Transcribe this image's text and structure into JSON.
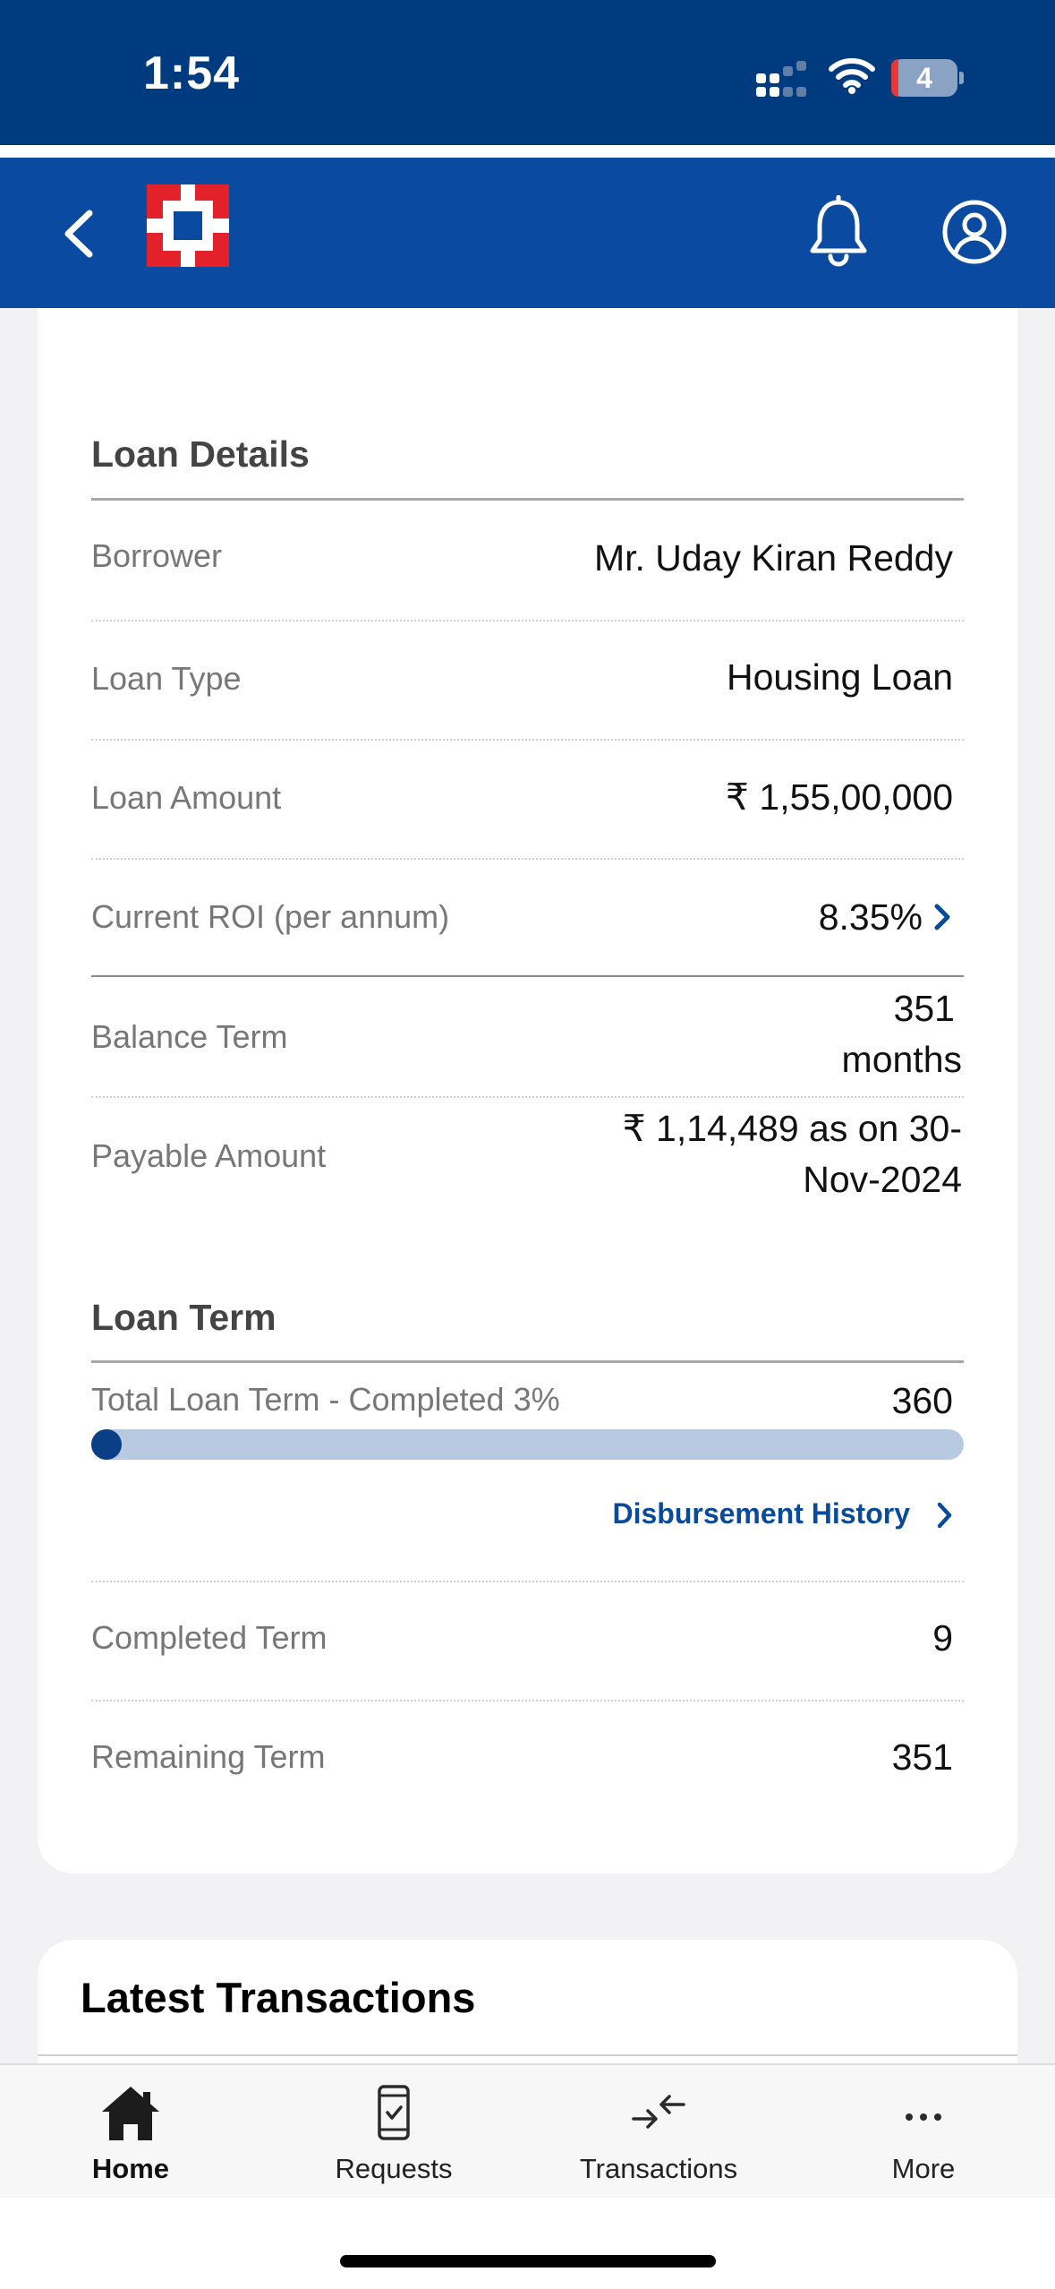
{
  "status_bar": {
    "time": "1:54",
    "battery": "4"
  },
  "colors": {
    "primary": "#0a4aa0",
    "status_bar": "#003b80",
    "logo_red": "#e3212b",
    "link": "#0a4a9a",
    "progress_fill": "#0a3f86",
    "progress_track": "#b8c9e2"
  },
  "header": {
    "back_icon": "chevron-left-icon",
    "logo_icon": "bank-logo",
    "notification_icon": "bell-icon",
    "profile_icon": "user-circle-icon"
  },
  "loan_details": {
    "title": "Loan Details",
    "rows": [
      {
        "label": "Borrower",
        "value": "Mr. Uday Kiran Reddy"
      },
      {
        "label": "Loan Type",
        "value": "Housing Loan"
      },
      {
        "label": "Loan Amount",
        "value": "₹ 1,55,00,000"
      },
      {
        "label": "Current ROI (per annum)",
        "value": "8.35%"
      },
      {
        "label": "Balance Term",
        "value_line1": "351",
        "value_line2": "months"
      },
      {
        "label": "Payable Amount",
        "value_line1": "₹ 1,14,489 as on 30-",
        "value_line2": "Nov-2024"
      }
    ]
  },
  "loan_term": {
    "title": "Loan Term",
    "progress_label": "Total Loan Term - Completed 3%",
    "total": "360",
    "progress_fraction": 0.03,
    "disbursement_link": "Disbursement History",
    "rows": [
      {
        "label": "Completed Term",
        "value": "9"
      },
      {
        "label": "Remaining Term",
        "value": "351"
      }
    ]
  },
  "latest_transactions": {
    "title": "Latest Transactions"
  },
  "tabs": [
    {
      "label": "Home",
      "icon": "home-icon",
      "active": true
    },
    {
      "label": "Requests",
      "icon": "phone-check-icon",
      "active": false
    },
    {
      "label": "Transactions",
      "icon": "transfer-arrows-icon",
      "active": false
    },
    {
      "label": "More",
      "icon": "ellipsis-icon",
      "active": false
    }
  ]
}
